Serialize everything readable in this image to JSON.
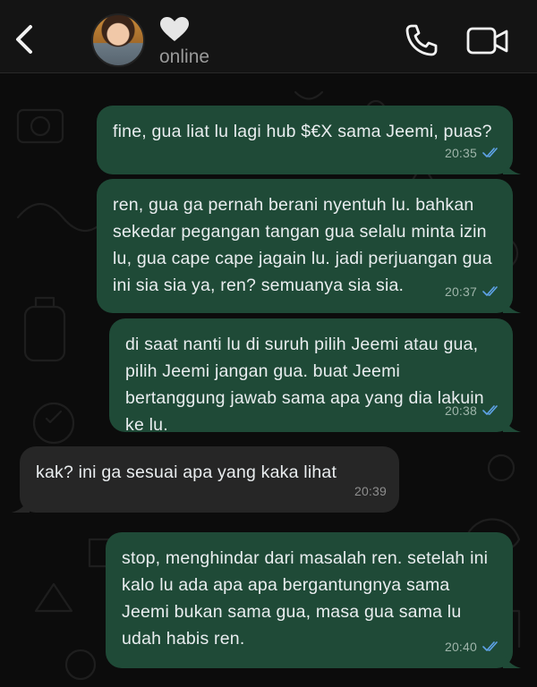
{
  "header": {
    "status": "online",
    "icons": {
      "back": "chevron-left-icon",
      "name": "heart-icon",
      "call": "phone-icon",
      "video": "video-camera-icon"
    }
  },
  "messages": [
    {
      "text": "fine, gua liat lu lagi hub $€X sama Jeemi, puas?",
      "time": "20:35",
      "direction": "out",
      "read": true
    },
    {
      "text": "ren, gua ga pernah berani nyentuh lu. bahkan sekedar pegangan tangan gua selalu minta izin lu, gua cape cape jagain lu. jadi perjuangan gua ini sia sia ya, ren? semuanya sia sia.",
      "time": "20:37",
      "direction": "out",
      "read": true
    },
    {
      "text": "di saat nanti lu di suruh pilih Jeemi atau gua, pilih Jeemi jangan gua. buat Jeemi bertanggung jawab sama apa yang dia lakuin ke lu.",
      "time": "20:38",
      "direction": "out",
      "read": true
    },
    {
      "text": "kak? ini ga sesuai apa yang kaka lihat",
      "time": "20:39",
      "direction": "in",
      "read": false
    },
    {
      "text": "stop, menghindar dari masalah ren. setelah ini kalo lu ada apa apa bergantungnya sama Jeemi bukan sama gua, masa gua sama lu udah habis ren.",
      "time": "20:40",
      "direction": "out",
      "read": true
    }
  ],
  "colors": {
    "outgoing_bubble": "#1f4a37",
    "incoming_bubble": "#262626",
    "read_ticks": "#5fa3e8",
    "background": "#0c0c0c"
  }
}
